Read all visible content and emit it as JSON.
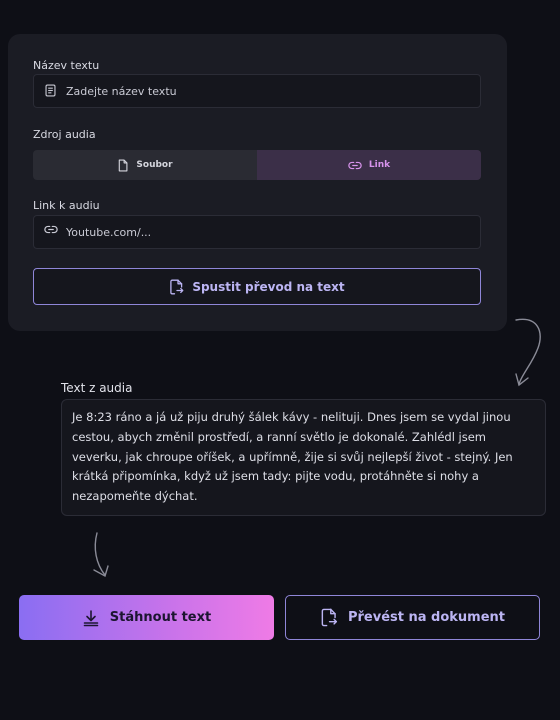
{
  "form": {
    "title_label": "Název textu",
    "title_placeholder": "Zadejte název textu",
    "source_label": "Zdroj audia",
    "source_options": [
      "Soubor",
      "Link"
    ],
    "source_selected": "Link",
    "link_label": "Link k audiu",
    "link_value": "Youtube.com/...",
    "convert_button": "Spustit převod na text"
  },
  "output": {
    "label": "Text z audia",
    "text": "Je 8:23 ráno a já už piju druhý šálek kávy - nelituji. Dnes jsem se vydal jinou cestou, abych změnil prostředí, a ranní světlo je dokonalé. Zahlédl jsem veverku, jak chroupe oříšek, a upřímně, žije si svůj nejlepší život - stejný. Jen krátká připomínka, když už jsem tady: pijte vodu, protáhněte si nohy a nezapomeňte dýchat."
  },
  "actions": {
    "download": "Stáhnout text",
    "to_document": "Převést na dokument"
  },
  "colors": {
    "background": "#0e0f16",
    "card": "#1b1c24",
    "accent": "#8f86d8",
    "active_segment": "#3b2f48",
    "gradient_start": "#8a6ef2",
    "gradient_end": "#ef7be6"
  },
  "icons": {
    "title_field": "document-lines-icon",
    "file_option": "file-icon",
    "link_option": "link-icon",
    "link_field": "link-icon",
    "convert": "file-convert-icon",
    "download": "download-icon",
    "to_document": "file-convert-icon"
  }
}
